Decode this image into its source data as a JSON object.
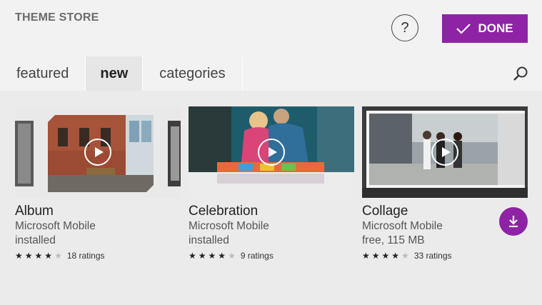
{
  "header": {
    "title": "THEME STORE",
    "help_label": "?",
    "done_label": "DONE"
  },
  "tabs": [
    {
      "label": "featured"
    },
    {
      "label": "new"
    },
    {
      "label": "categories"
    }
  ],
  "active_tab": "new",
  "icons": {
    "search": "search-icon",
    "help": "help-icon",
    "check": "check-icon",
    "play": "play-icon",
    "download": "download-icon"
  },
  "colors": {
    "accent": "#8e23a6"
  },
  "themes": [
    {
      "title": "Album",
      "publisher": "Microsoft Mobile",
      "status": "installed",
      "stars": 4,
      "ratings": "18 ratings"
    },
    {
      "title": "Celebration",
      "publisher": "Microsoft Mobile",
      "status": "installed",
      "stars": 4,
      "ratings": "9 ratings"
    },
    {
      "title": "Collage",
      "publisher": "Microsoft Mobile",
      "status": "free, 115 MB",
      "stars": 4,
      "ratings": "33 ratings"
    }
  ]
}
